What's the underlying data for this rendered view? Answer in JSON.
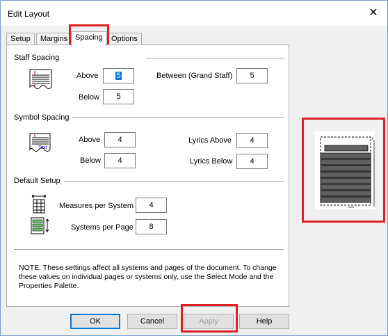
{
  "window": {
    "title": "Edit Layout",
    "close_glyph": "✕"
  },
  "tabs": [
    {
      "label": "Setup"
    },
    {
      "label": "Margins"
    },
    {
      "label": "Spacing",
      "active": true
    },
    {
      "label": "Options"
    }
  ],
  "staff_spacing": {
    "heading": "Staff Spacing",
    "above_label": "Above",
    "above_value": "5",
    "below_label": "Below",
    "below_value": "5",
    "between_label": "Between (Grand Staff)",
    "between_value": "5"
  },
  "symbol_spacing": {
    "heading": "Symbol Spacing",
    "above_label": "Above",
    "above_value": "4",
    "below_label": "Below",
    "below_value": "4",
    "lyrics_above_label": "Lyrics Above",
    "lyrics_above_value": "4",
    "lyrics_below_label": "Lyrics Below",
    "lyrics_below_value": "4",
    "icon_text": "Text"
  },
  "default_setup": {
    "heading": "Default Setup",
    "measures_label": "Measures per System",
    "measures_value": "4",
    "systems_label": "Systems per Page",
    "systems_value": "8"
  },
  "note": "NOTE: These settings affect all systems and pages of the document. To change these values on individual pages or systems only, use the Select Mode and the Properties Palette.",
  "buttons": {
    "ok": "OK",
    "cancel": "Cancel",
    "apply": "Apply",
    "help": "Help"
  },
  "colors": {
    "highlight": "#e02020",
    "selection": "#0078d7"
  }
}
